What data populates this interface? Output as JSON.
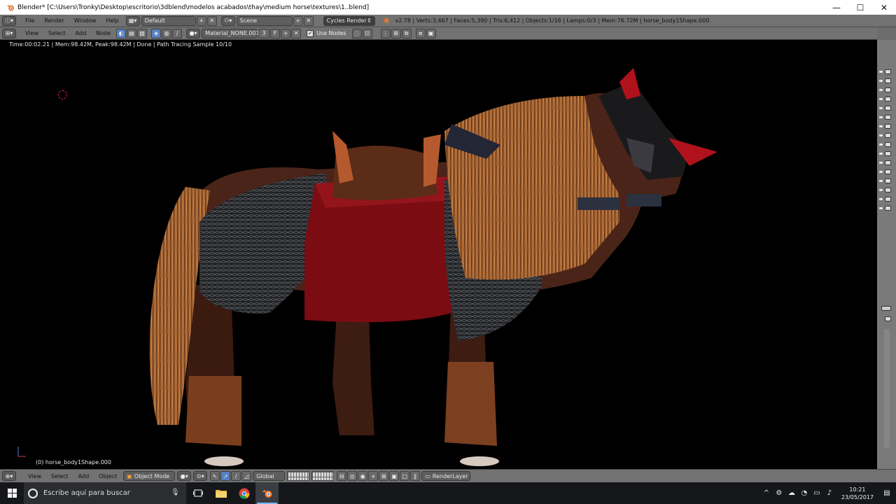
{
  "window": {
    "title": "Blender* [C:\\Users\\Tronky\\Desktop\\escritorio\\3dblend\\modelos acabados\\thay\\medium horse\\textures\\1..blend]",
    "minimize": "—",
    "maximize": "☐",
    "close": "✕"
  },
  "info_header": {
    "menus": [
      "File",
      "Render",
      "Window",
      "Help"
    ],
    "layout": "Default",
    "scene": "Scene",
    "engine": "Cycles Render",
    "stats": "v2.78 | Verts:3,467 | Faces:5,390 | Tris:6,412 | Objects:1/16 | Lamps:0/3 | Mem:76.72M | horse_body1Shape.000"
  },
  "node_header": {
    "menus": [
      "View",
      "Select",
      "Add",
      "Node"
    ],
    "material": "Material_NONE.001",
    "users": "3",
    "fake_user": "F",
    "use_nodes_label": "Use Nodes"
  },
  "viewport": {
    "render_status": "Time:00:02.21 | Mem:98.42M, Peak:98.42M | Done | Path Tracing Sample 10/10",
    "object_name": "(0) horse_body1Shape.000"
  },
  "view3d_header": {
    "menus": [
      "View",
      "Select",
      "Add",
      "Object"
    ],
    "mode": "Object Mode",
    "orientation": "Global",
    "render_layer": "RenderLayer"
  },
  "taskbar": {
    "search_placeholder": "Escribe aquí para buscar",
    "time": "10:21",
    "date": "23/05/2017"
  },
  "colors": {
    "header_bg": "#727272",
    "button_selected": "#5680c2",
    "taskbar_bg": "#15171a"
  }
}
